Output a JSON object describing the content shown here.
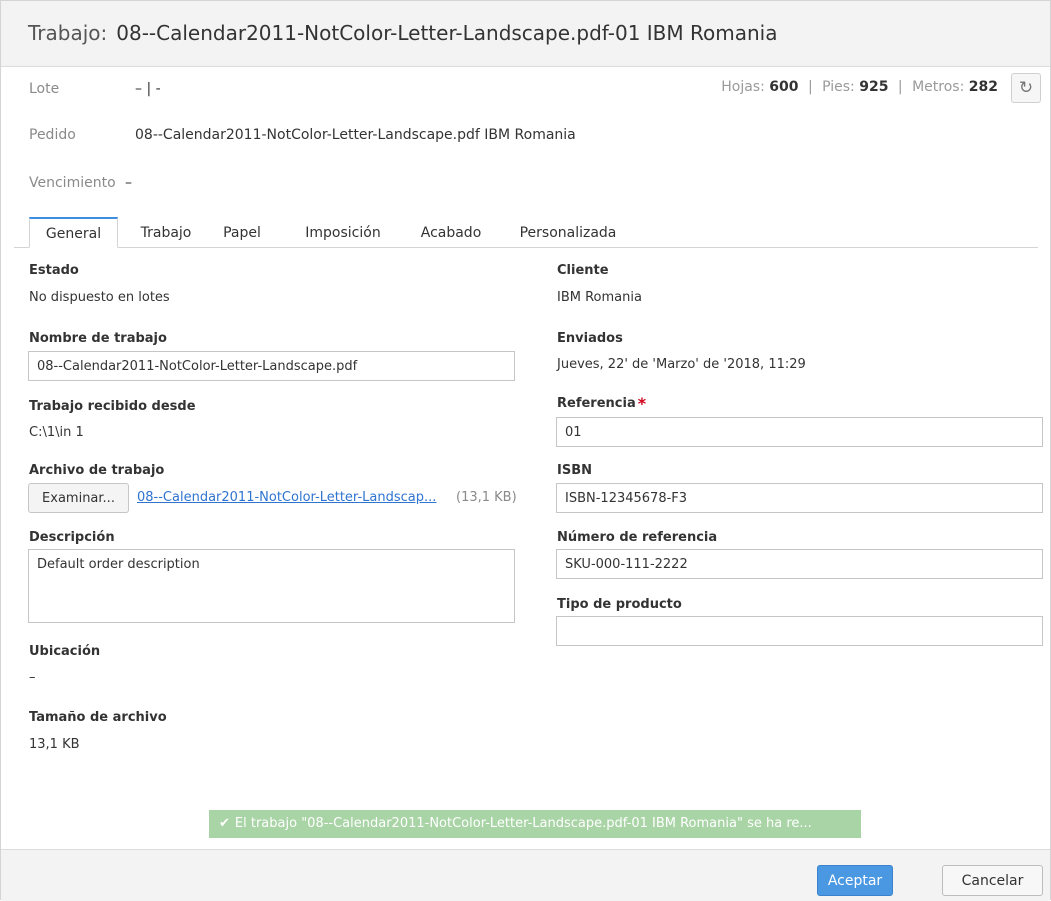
{
  "header": {
    "title_label": "Trabajo:",
    "title_value": "08--Calendar2011-NotColor-Letter-Landscape.pdf-01 IBM Romania"
  },
  "info": {
    "lote_label": "Lote",
    "lote_value": "– | -",
    "pedido_label": "Pedido",
    "pedido_value": "08--Calendar2011-NotColor-Letter-Landscape.pdf IBM Romania",
    "vencimiento_label": "Vencimiento",
    "vencimiento_value": "–"
  },
  "stats": {
    "hojas_label": "Hojas:",
    "hojas_value": "600",
    "pies_label": "Pies:",
    "pies_value": "925",
    "metros_label": "Metros:",
    "metros_value": "282",
    "separator": "|",
    "refresh_icon": "↻"
  },
  "tabs": [
    {
      "label": "General",
      "active": true
    },
    {
      "label": "Trabajo"
    },
    {
      "label": "Papel"
    },
    {
      "label": "Imposición"
    },
    {
      "label": "Acabado"
    },
    {
      "label": "Personalizada"
    }
  ],
  "left": {
    "estado_label": "Estado",
    "estado_value": "No dispuesto en lotes",
    "nombre_label": "Nombre de trabajo",
    "nombre_value": "08--Calendar2011-NotColor-Letter-Landscape.pdf",
    "recibido_label": "Trabajo recibido desde",
    "recibido_value": "C:\\1\\in 1",
    "archivo_label": "Archivo de trabajo",
    "browse_label": "Examinar...",
    "file_link": "08--Calendar2011-NotColor-Letter-Landscap...",
    "file_size": "(13,1 KB)",
    "descripcion_label": "Descripción",
    "descripcion_value": "Default order description",
    "ubicacion_label": "Ubicación",
    "ubicacion_value": "–",
    "tamano_label": "Tamaño de archivo",
    "tamano_value": "13,1 KB"
  },
  "right": {
    "cliente_label": "Cliente",
    "cliente_value": "IBM Romania",
    "enviados_label": "Enviados",
    "enviados_value": "Jueves, 22' de 'Marzo' de '2018, 11:29",
    "referencia_label": "Referencia",
    "referencia_required": "*",
    "referencia_value": "01",
    "isbn_label": "ISBN",
    "isbn_value": "ISBN-12345678-F3",
    "numref_label": "Número de referencia",
    "numref_value": "SKU-000-111-2222",
    "tipo_label": "Tipo de producto",
    "tipo_value": ""
  },
  "toast": {
    "icon": "✔",
    "text": "El trabajo \"08--Calendar2011-NotColor-Letter-Landscape.pdf-01 IBM Romania\" se ha re..."
  },
  "footer": {
    "accept_label": "Aceptar",
    "cancel_label": "Cancelar"
  },
  "colors": {
    "accent": "#4a97e2",
    "link": "#2f74d0",
    "toast_bg": "#a9d4a6",
    "required": "#d0021b"
  }
}
